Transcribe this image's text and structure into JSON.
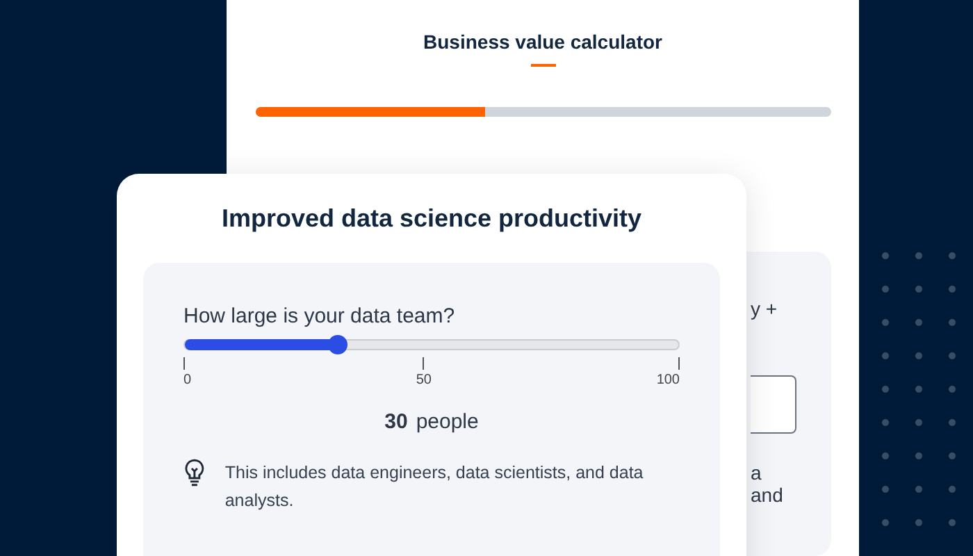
{
  "calculator": {
    "title": "Business value calculator",
    "progress": {
      "level": 0.4
    }
  },
  "back_card": {
    "texts": [
      "y +",
      "a",
      "and"
    ]
  },
  "front_card": {
    "title": "Improved data science productivity",
    "question": "How large is your data team?",
    "slider": {
      "level": 0.31,
      "ticks": [
        "0",
        "50",
        "100"
      ]
    },
    "value": "30",
    "unit": "people",
    "tip": "This includes data engineers, data scientists, and data analysts."
  }
}
